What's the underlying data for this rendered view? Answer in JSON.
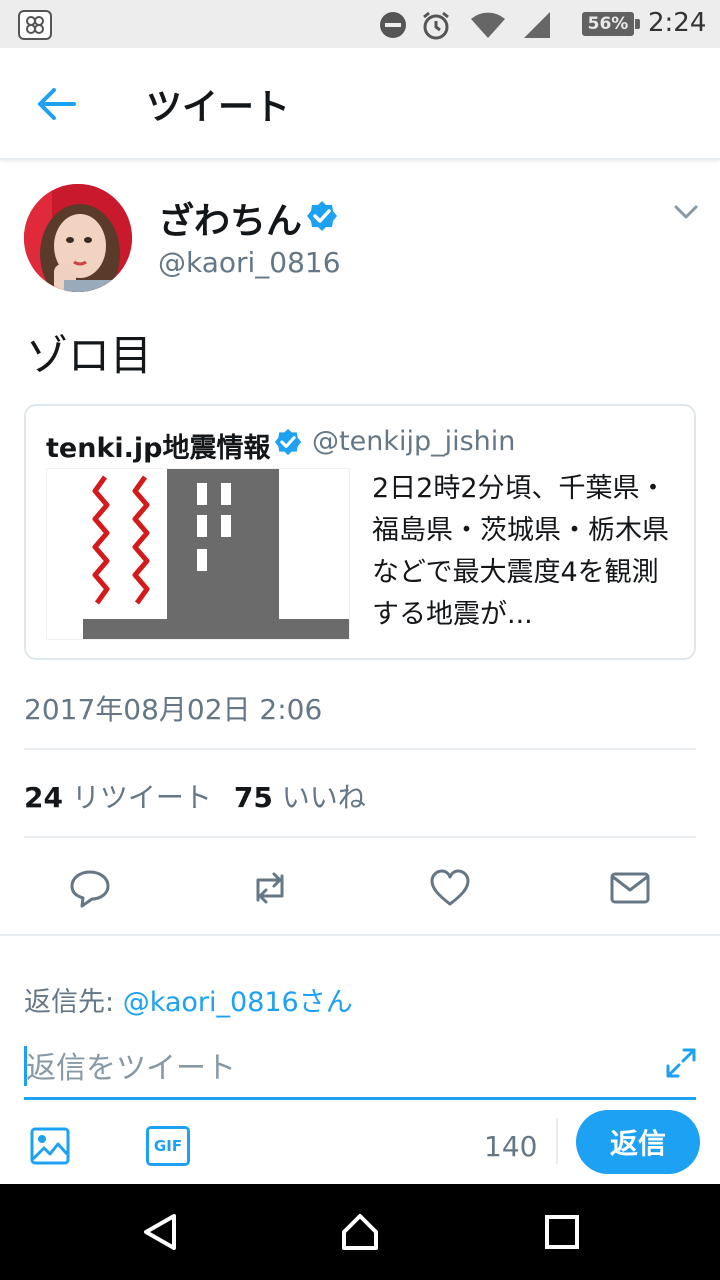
{
  "status_bar": {
    "battery": "56%",
    "time": "2:24"
  },
  "header": {
    "title": "ツイート"
  },
  "tweet": {
    "user_name": "ざわちん",
    "user_handle": "@kaori_0816",
    "text": "ゾロ目",
    "timestamp": "2017年08月02日 2:06",
    "retweet_count": "24",
    "retweet_label": "リツイート",
    "like_count": "75",
    "like_label": "いいね"
  },
  "quote": {
    "name": "tenki.jp地震情報",
    "handle": "@tenkijp_jishin",
    "text": "2日2時2分頃、千葉県・福島県・茨城県・栃木県などで最大震度4を観測する地震が..."
  },
  "reply": {
    "reply_to_label": "返信先: ",
    "reply_to_mention": "@kaori_0816さん",
    "placeholder": "返信をツイート",
    "gif_label": "GIF",
    "char_count": "140",
    "submit_label": "返信"
  },
  "colors": {
    "accent": "#1da1f2",
    "secondary_text": "#657786",
    "divider": "#e6ecf0"
  },
  "icons": {
    "actions": [
      "reply-icon",
      "retweet-icon",
      "like-icon",
      "direct-message-icon"
    ],
    "nav": [
      "back-triangle-icon",
      "home-icon",
      "recents-icon"
    ]
  }
}
